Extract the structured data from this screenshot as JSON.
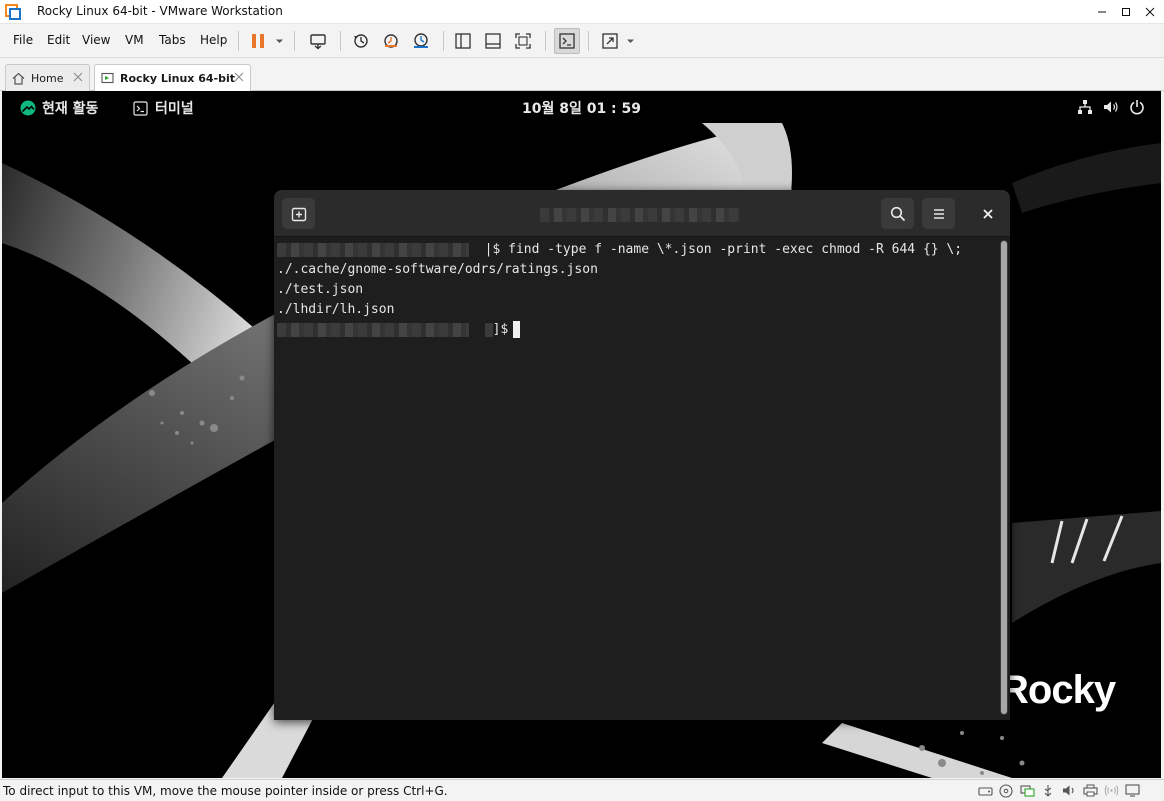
{
  "window": {
    "title": "Rocky Linux 64-bit - VMware Workstation"
  },
  "menu": [
    "File",
    "Edit",
    "View",
    "VM",
    "Tabs",
    "Help"
  ],
  "tabs": [
    {
      "label": "Home",
      "icon": "home-icon"
    },
    {
      "label": "Rocky Linux 64-bit",
      "icon": "vm-icon"
    }
  ],
  "guest": {
    "activities_label": "현재 활동",
    "app_label": "터미널",
    "clock": "10월 8일  01 : 59",
    "brand": "Rocky"
  },
  "terminal": {
    "lines": [
      {
        "prompt_suffix": "|$ ",
        "command": "find -type f -name \\*.json -print -exec chmod -R 644 {} \\;"
      },
      {
        "text": "./.cache/gnome-software/odrs/ratings.json"
      },
      {
        "text": "./test.json"
      },
      {
        "text": "./lhdir/lh.json"
      },
      {
        "prompt_suffix": "]$"
      }
    ]
  },
  "status": {
    "hint": "To direct input to this VM, move the mouse pointer inside or press Ctrl+G."
  },
  "colors": {
    "pause_accent": "#e8762d",
    "rocky_green": "#10b981",
    "terminal_bg": "#1e1e1e"
  }
}
